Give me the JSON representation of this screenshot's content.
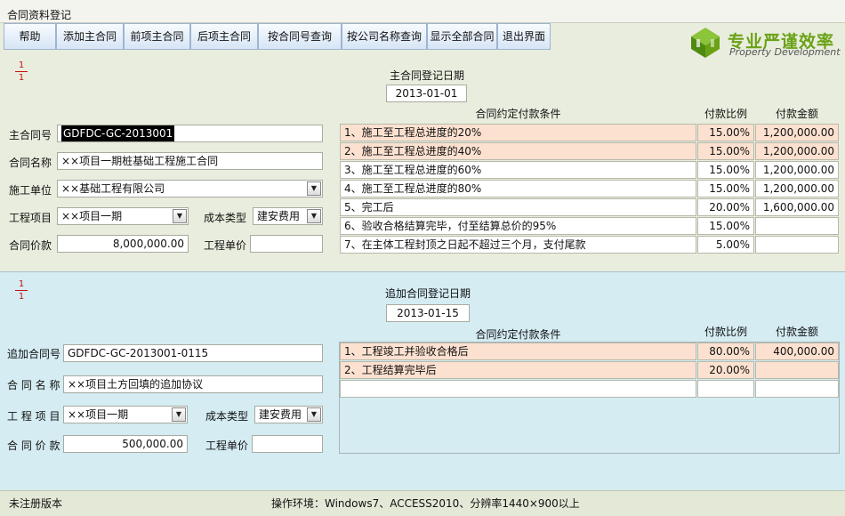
{
  "window": {
    "title": "合同资料登记"
  },
  "toolbar": {
    "help": "帮助",
    "add_main": "添加主合同",
    "prev_main": "前项主合同",
    "next_main": "后项主合同",
    "query_by_no": "按合同号查询",
    "query_by_company": "按公司名称查询",
    "show_all": "显示全部合同",
    "exit": "退出界面"
  },
  "logo": {
    "cn": "专业严谨效率",
    "en": "Property Development"
  },
  "main": {
    "page_current": "1",
    "page_total": "1",
    "date_label": "主合同登记日期",
    "date": "2013-01-01",
    "contract_no_label": "主合同号",
    "contract_no": "GDFDC-GC-2013001",
    "contract_name_label": "合同名称",
    "contract_name": "××项目一期桩基础工程施工合同",
    "contractor_label": "施工单位",
    "contractor": "××基础工程有限公司",
    "project_label": "工程项目",
    "project": "××项目一期",
    "cost_type_label": "成本类型",
    "cost_type": "建安费用",
    "price_label": "合同价款",
    "price": "8,000,000.00",
    "unit_price_label": "工程单价",
    "unit_price": "",
    "terms_header": "合同约定付款条件",
    "ratio_header": "付款比例",
    "amount_header": "付款金额",
    "terms": [
      {
        "cond": "1、施工至工程总进度的20%",
        "ratio": "15.00%",
        "amount": "1,200,000.00"
      },
      {
        "cond": "2、施工至工程总进度的40%",
        "ratio": "15.00%",
        "amount": "1,200,000.00"
      },
      {
        "cond": "3、施工至工程总进度的60%",
        "ratio": "15.00%",
        "amount": "1,200,000.00"
      },
      {
        "cond": "4、施工至工程总进度的80%",
        "ratio": "15.00%",
        "amount": "1,200,000.00"
      },
      {
        "cond": "5、完工后",
        "ratio": "20.00%",
        "amount": "1,600,000.00"
      },
      {
        "cond": "6、验收合格结算完毕，付至结算总价的95%",
        "ratio": "15.00%",
        "amount": ""
      },
      {
        "cond": "7、在主体工程封顶之日起不超过三个月，支付尾款",
        "ratio": "5.00%",
        "amount": ""
      }
    ]
  },
  "addendum": {
    "page_current": "1",
    "page_total": "1",
    "date_label": "追加合同登记日期",
    "date": "2013-01-15",
    "contract_no_label": "追加合同号",
    "contract_no": "GDFDC-GC-2013001-0115",
    "contract_name_label": "合 同 名 称",
    "contract_name": "××项目土方回填的追加协议",
    "project_label": "工 程 项 目",
    "project": "××项目一期",
    "cost_type_label": "成本类型",
    "cost_type": "建安费用",
    "price_label": "合 同 价 款",
    "price": "500,000.00",
    "unit_price_label": "工程单价",
    "unit_price": "",
    "terms_header": "合同约定付款条件",
    "ratio_header": "付款比例",
    "amount_header": "付款金额",
    "terms": [
      {
        "cond": "1、工程竣工并验收合格后",
        "ratio": "80.00%",
        "amount": "400,000.00"
      },
      {
        "cond": "2、工程结算完毕后",
        "ratio": "20.00%",
        "amount": ""
      },
      {
        "cond": "",
        "ratio": "",
        "amount": ""
      }
    ]
  },
  "status": {
    "version": "未注册版本",
    "env": "操作环境：Windows7、ACCESS2010、分辨率1440×900以上"
  },
  "colors": {
    "highlight_row": "#fde1d0",
    "lower_panel": "#d4ecf2",
    "upper_panel": "#e9edde",
    "logo_green": "#6aa216"
  }
}
